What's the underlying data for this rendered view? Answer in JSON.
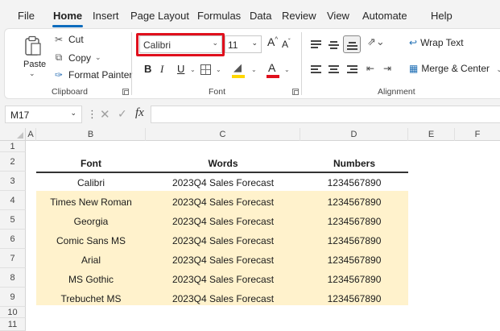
{
  "menu": {
    "tabs": [
      "File",
      "Home",
      "Insert",
      "Page Layout",
      "Formulas",
      "Data",
      "Review",
      "View",
      "Automate",
      "Help"
    ]
  },
  "ribbon": {
    "clipboard": {
      "paste": "Paste",
      "cut": "Cut",
      "copy": "Copy",
      "format_painter": "Format Painter",
      "label": "Clipboard"
    },
    "font": {
      "name": "Calibri",
      "size": "11",
      "label": "Font",
      "fill_color": "#ffd700",
      "font_color": "#e0101d"
    },
    "alignment": {
      "wrap_text": "Wrap Text",
      "merge_center": "Merge & Center",
      "label": "Alignment"
    }
  },
  "formula_bar": {
    "name_box": "M17",
    "fx": "fx",
    "content": ""
  },
  "grid": {
    "columns": [
      "A",
      "B",
      "C",
      "D",
      "E",
      "F"
    ],
    "rows": [
      "1",
      "2",
      "3",
      "4",
      "5",
      "6",
      "7",
      "8",
      "9",
      "10",
      "11"
    ],
    "headers": {
      "font": "Font",
      "words": "Words",
      "numbers": "Numbers"
    },
    "data": [
      {
        "font": "Calibri",
        "words": "2023Q4 Sales Forecast",
        "numbers": "1234567890"
      },
      {
        "font": "Times New Roman",
        "words": "2023Q4 Sales Forecast",
        "numbers": "1234567890"
      },
      {
        "font": "Georgia",
        "words": "2023Q4 Sales Forecast",
        "numbers": "1234567890"
      },
      {
        "font": "Comic Sans MS",
        "words": "2023Q4 Sales Forecast",
        "numbers": "1234567890"
      },
      {
        "font": "Arial",
        "words": "2023Q4 Sales Forecast",
        "numbers": "1234567890"
      },
      {
        "font": "MS Gothic",
        "words": "2023Q4 Sales Forecast",
        "numbers": "1234567890"
      },
      {
        "font": "Trebuchet MS",
        "words": "2023Q4 Sales Forecast",
        "numbers": "1234567890"
      }
    ],
    "highlight_color": "#fff2cc"
  },
  "colors": {
    "accent": "#0f6cbd",
    "highlight_box": "#e0101d"
  }
}
